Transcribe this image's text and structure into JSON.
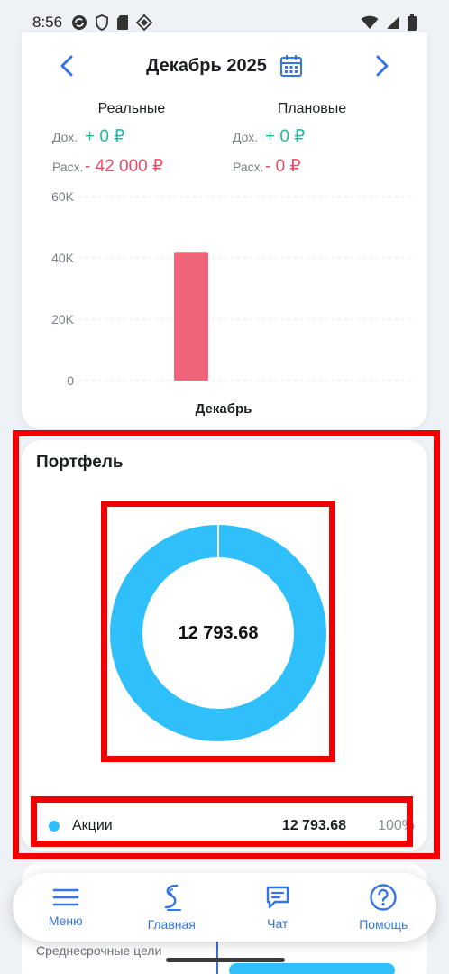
{
  "status_bar": {
    "time": "8:56"
  },
  "month_card": {
    "title": "Декабрь 2025",
    "real": {
      "header": "Реальные",
      "income_label": "Дох.",
      "income_value": "+ 0 ₽",
      "expense_label": "Расх.",
      "expense_value": "- 42 000 ₽"
    },
    "planned": {
      "header": "Плановые",
      "income_label": "Дох.",
      "income_value": "+ 0 ₽",
      "expense_label": "Расх.",
      "expense_value": "- 0 ₽"
    }
  },
  "colors": {
    "accent": "#3574e6",
    "income": "#23b6a0",
    "expense": "#e84d65",
    "bar": "#f06378",
    "donut": "#2fc0fb",
    "highlight": "#f20000"
  },
  "chart_data": {
    "type": "bar",
    "categories": [
      "Декабрь"
    ],
    "values": [
      42000
    ],
    "ylim": [
      0,
      60000
    ],
    "yticks": [
      0,
      20000,
      40000,
      60000
    ],
    "ytick_labels": [
      "0",
      "20K",
      "40K",
      "60K"
    ],
    "grid": true
  },
  "portfolio": {
    "title": "Портфель",
    "total": "12 793.68",
    "items": [
      {
        "label": "Акции",
        "amount": "12 793.68",
        "percent": "100%",
        "fraction": 1.0
      }
    ]
  },
  "bottom_card": {
    "label": "Среднесрочные цели"
  },
  "bottom_nav": [
    {
      "label": "Меню",
      "icon": "menu-icon"
    },
    {
      "label": "Главная",
      "icon": "home-logo-icon"
    },
    {
      "label": "Чат",
      "icon": "chat-icon"
    },
    {
      "label": "Помощь",
      "icon": "help-icon"
    }
  ]
}
